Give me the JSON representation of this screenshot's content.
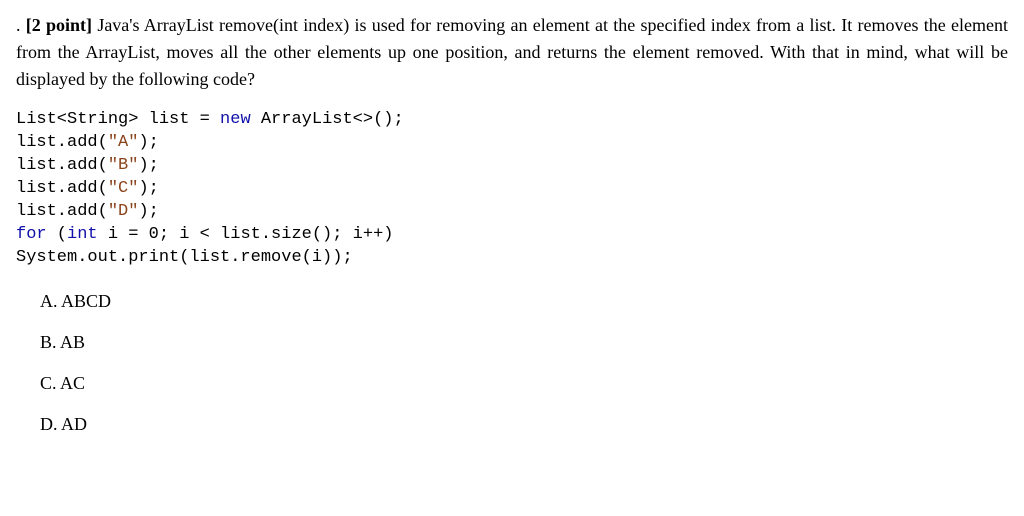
{
  "question": {
    "prefix": ".",
    "points_label": "[2 point]",
    "intro_text": "Java's ArrayList remove(int index) is used for removing an element at the specified index from a list. It removes the element from the ArrayList, moves all the other elements up one position, and returns the element removed. With that in mind, what will be displayed by the following code?"
  },
  "code": {
    "l1_a": "List<String> list = ",
    "l1_kw": "new",
    "l1_b": " ArrayList<>();",
    "l2_a": "list.add(",
    "l2_s": "\"A\"",
    "l2_b": ");",
    "l3_a": "list.add(",
    "l3_s": "\"B\"",
    "l3_b": ");",
    "l4_a": "list.add(",
    "l4_s": "\"C\"",
    "l4_b": ");",
    "l5_a": "list.add(",
    "l5_s": "\"D\"",
    "l5_b": ");",
    "l6_kw": "for",
    "l6_a": " (",
    "l6_kw2": "int",
    "l6_b": " i = 0; i < list.size(); i++)",
    "l7": "System.out.print(list.remove(i));"
  },
  "options": {
    "a": {
      "label": "A.",
      "text": "ABCD"
    },
    "b": {
      "label": "B.",
      "text": "AB"
    },
    "c": {
      "label": "C.",
      "text": "AC"
    },
    "d": {
      "label": "D.",
      "text": "AD"
    }
  }
}
